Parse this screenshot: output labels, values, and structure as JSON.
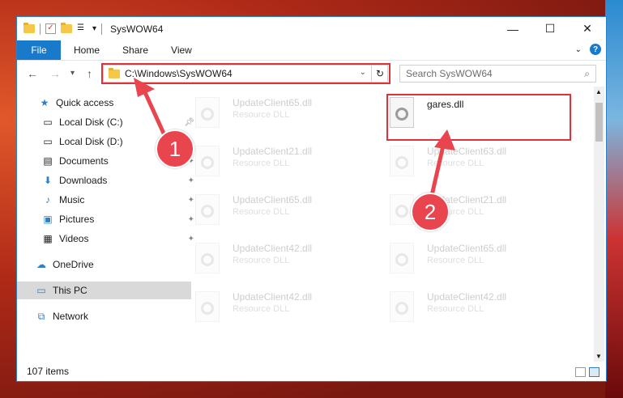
{
  "window": {
    "title": "SysWOW64",
    "minimize": "—",
    "maximize": "☐",
    "close": "✕"
  },
  "ribbon": {
    "tabs": [
      "File",
      "Home",
      "Share",
      "View"
    ],
    "help": "?"
  },
  "nav": {
    "back": "←",
    "forward": "→",
    "recent": "▾",
    "up": "↑",
    "address": "C:\\Windows\\SysWOW64",
    "refresh": "↻",
    "search_placeholder": "Search SysWOW64"
  },
  "sidebar": {
    "items": [
      {
        "label": "Quick access",
        "icon": "star-icon"
      },
      {
        "label": "Local Disk (C:)",
        "icon": "drive-icon"
      },
      {
        "label": "Local Disk (D:)",
        "icon": "drive-icon"
      },
      {
        "label": "Documents",
        "icon": "documents-icon"
      },
      {
        "label": "Downloads",
        "icon": "download-icon"
      },
      {
        "label": "Music",
        "icon": "music-icon"
      },
      {
        "label": "Pictures",
        "icon": "pictures-icon"
      },
      {
        "label": "Videos",
        "icon": "videos-icon"
      },
      {
        "label": "OneDrive",
        "icon": "cloud-icon"
      },
      {
        "label": "This PC",
        "icon": "computer-icon"
      },
      {
        "label": "Network",
        "icon": "network-icon"
      }
    ]
  },
  "files": [
    {
      "name": "UpdateClient65.dll",
      "type": "Resource DLL"
    },
    {
      "name": "gares.dll",
      "type": ""
    },
    {
      "name": "UpdateClient21.dll",
      "type": "Resource DLL"
    },
    {
      "name": "UpdateClient63.dll",
      "type": "Resource DLL"
    },
    {
      "name": "UpdateClient65.dll",
      "type": "Resource DLL"
    },
    {
      "name": "UpdateClient21.dll",
      "type": "Resource DLL"
    },
    {
      "name": "UpdateClient42.dll",
      "type": "Resource DLL"
    },
    {
      "name": "UpdateClient65.dll",
      "type": "Resource DLL"
    },
    {
      "name": "UpdateClient42.dll",
      "type": "Resource DLL"
    },
    {
      "name": "UpdateClient42.dll",
      "type": "Resource DLL"
    }
  ],
  "status": {
    "count": "107 items"
  },
  "annotations": {
    "badge1": "1",
    "badge2": "2"
  },
  "colors": {
    "accent": "#1979ca",
    "highlight": "#e0303a",
    "badge": "#e8454f"
  }
}
